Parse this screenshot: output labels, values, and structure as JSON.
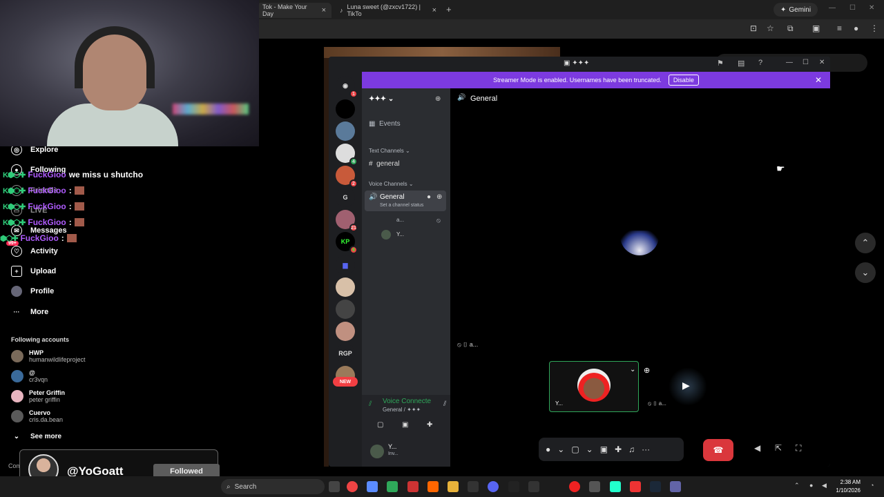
{
  "browser": {
    "tabs": [
      {
        "label": "Tok - Make Your Day"
      },
      {
        "label": "Luna sweet (@zxcv1722) | TikTo"
      }
    ],
    "gemini_label": "Gemini",
    "new_tab": "+"
  },
  "tiktok": {
    "nav": [
      {
        "label": "Explore",
        "icon": "compass-icon"
      },
      {
        "label": "Following",
        "icon": "following-icon"
      },
      {
        "label": "Friends",
        "icon": "friends-icon"
      },
      {
        "label": "LIVE",
        "icon": "live-icon"
      },
      {
        "label": "Messages",
        "icon": "messages-icon"
      },
      {
        "label": "Activity",
        "icon": "activity-icon",
        "badge": "99+"
      },
      {
        "label": "Upload",
        "icon": "upload-icon"
      },
      {
        "label": "Profile",
        "icon": "profile-icon"
      },
      {
        "label": "More",
        "icon": "more-icon"
      }
    ],
    "following_title": "Following accounts",
    "accounts": [
      {
        "name": "HWP",
        "handle": "humanwildlifeproject"
      },
      {
        "name": "@",
        "handle": "cr3vqn"
      },
      {
        "name": "Peter Griffin",
        "handle": "peter griffin"
      },
      {
        "name": "Cuervo",
        "handle": "cris.da.bean"
      }
    ],
    "see_more": "See more",
    "company": "Com"
  },
  "chat": [
    {
      "name": "FuckGioo",
      "msg": "we miss u shutcho"
    },
    {
      "name": "FuckGioo",
      "msg": ":"
    },
    {
      "name": "FuckGioo",
      "msg": ":"
    },
    {
      "name": "FuckGioo",
      "msg": ":"
    },
    {
      "name": "FuckGioo",
      "msg": ":"
    }
  ],
  "follow_card": {
    "handle": "@YoGoatt",
    "button": "Followed"
  },
  "discord": {
    "title": "✦✦✦",
    "banner_text": "Streamer Mode is enabled. Usernames have been truncated.",
    "banner_button": "Disable",
    "server_name": "✦✦✦",
    "events": "Events",
    "text_channels": "Text Channels",
    "text_channel": "general",
    "voice_channels": "Voice Channels",
    "voice_channel": "General",
    "channel_status": "Set a channel status",
    "voice_users": [
      "a...",
      "Y..."
    ],
    "main_title": "General",
    "servers": [
      {
        "label": "",
        "badge": "1"
      },
      {
        "label": "",
        "badge": ""
      },
      {
        "label": "",
        "badge": ""
      },
      {
        "label": "",
        "badge": "4"
      },
      {
        "label": "",
        "badge": "2"
      },
      {
        "label": "G",
        "badge": ""
      },
      {
        "label": "",
        "badge": "21"
      },
      {
        "label": "KP",
        "badge": "6"
      },
      {
        "label": "",
        "badge": ""
      },
      {
        "label": "",
        "badge": ""
      },
      {
        "label": "",
        "badge": ""
      },
      {
        "label": "",
        "badge": ""
      },
      {
        "label": "RGP",
        "badge": ""
      },
      {
        "label": "",
        "badge": ""
      }
    ],
    "new_label": "NEW",
    "voice_connected": "Voice Connecte",
    "voice_location": "General / ✦✦✦",
    "user_short": "Y...",
    "user_status": "Inv...",
    "tile_user": "Y...",
    "tile_other": "a...",
    "stage_user": "a..."
  },
  "taskbar": {
    "search": "Search",
    "time": "2:38 AM",
    "date": "1/10/2026"
  },
  "colors": {
    "discord_accent": "#7c3ae0",
    "end_call": "#da373c",
    "chat_name": "#b05cff"
  }
}
